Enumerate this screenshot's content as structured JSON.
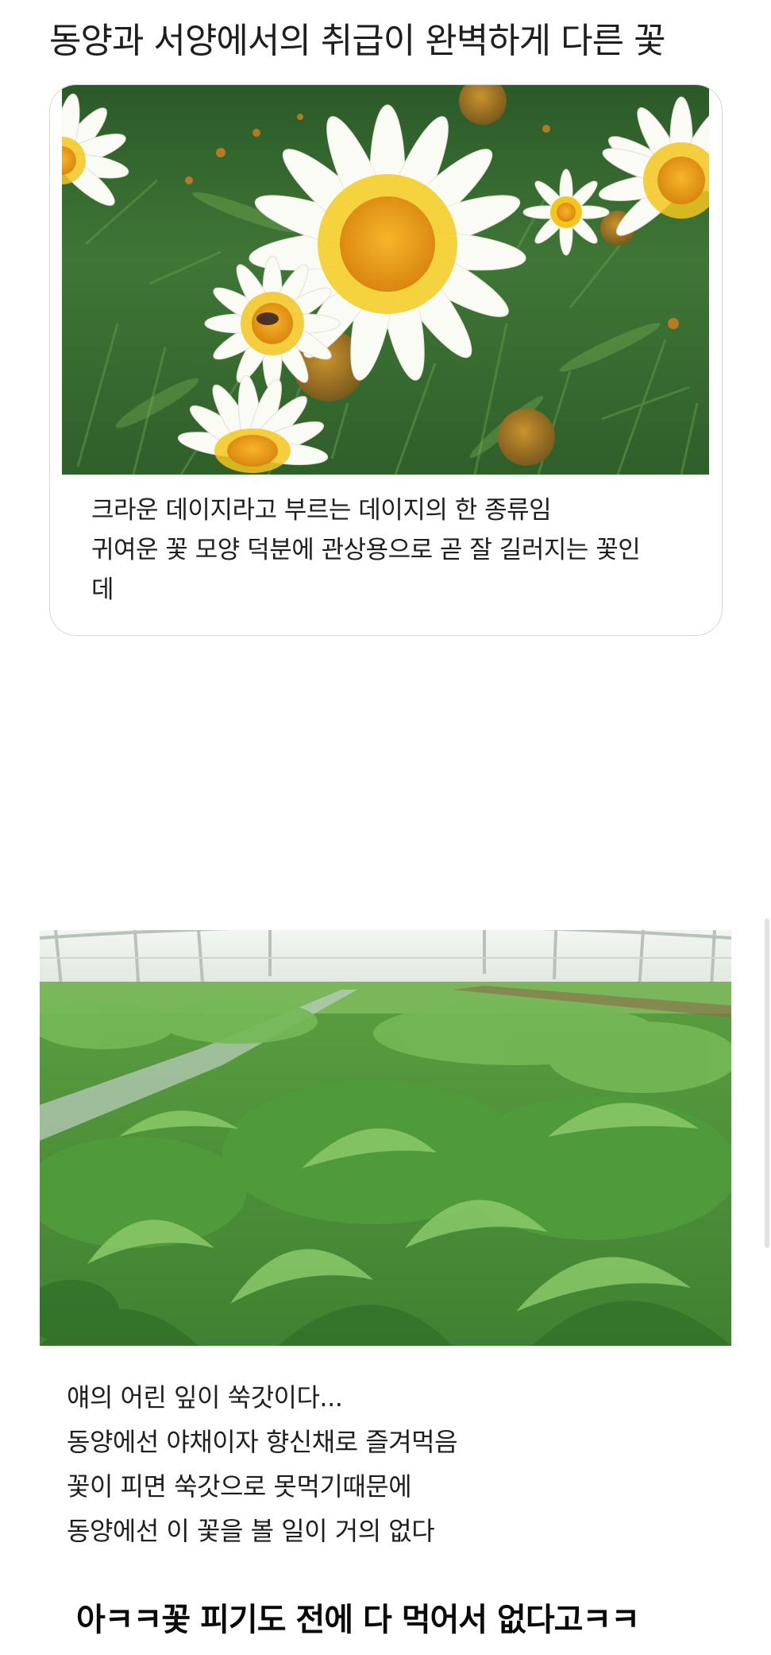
{
  "post": {
    "title": "동양과 서양에서의 취급이 완벽하게 다른 꽃",
    "card": {
      "image": "crown-daisy-flowers-photo",
      "lines": [
        "크라운 데이지라고 부르는 데이지의 한 종류임",
        "귀여운 꽃 모양 덕분에 관상용으로 곧 잘 길러지는 꽃인",
        "데"
      ]
    },
    "plant_image": "crown-daisy-greenhouse-photo",
    "body_lines": [
      "얘의 어린 잎이 쑥갓이다...",
      "동양에선 야채이자 향신채로 즐겨먹음",
      "꽃이 피면 쑥갓으로 못먹기때문에",
      "동양에선 이 꽃을 볼 일이 거의 없다"
    ],
    "punchline": "아ㅋㅋ꽃 피기도 전에 다 먹어서 없다고ㅋㅋ"
  },
  "colors": {
    "petal": "#ffffff",
    "petal_base": "#f2c21a",
    "flower_center": "#f0a21c",
    "foliage": "#3d7535",
    "leaf_light": "#6fb24a",
    "text": "#1e1e1e",
    "card_border": "#d6d6d6"
  }
}
